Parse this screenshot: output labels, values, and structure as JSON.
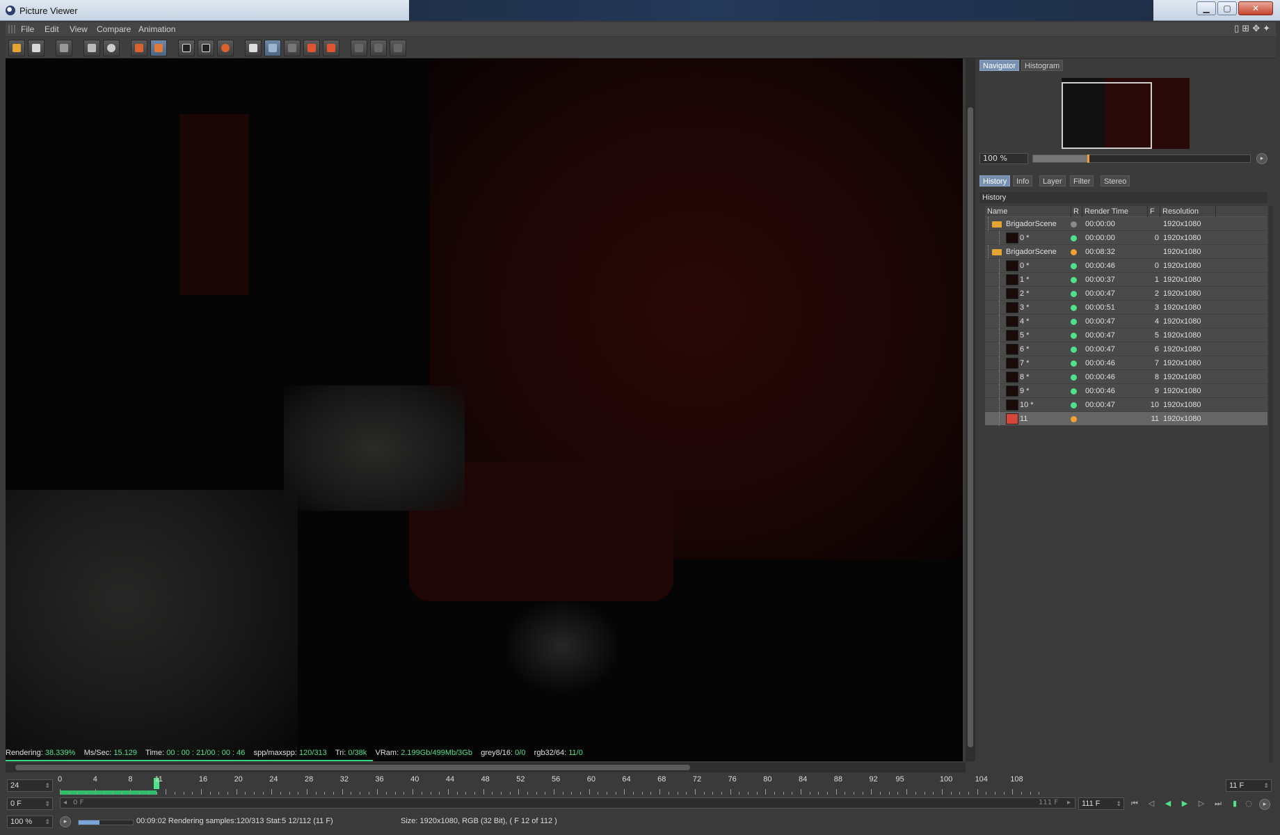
{
  "window": {
    "title": "Picture Viewer"
  },
  "menu": [
    "File",
    "Edit",
    "View",
    "Compare",
    "Animation"
  ],
  "status": {
    "rendering_label": "Rendering:",
    "rendering": "38.339%",
    "ms_label": "Ms/Sec:",
    "ms": "15.129",
    "time_label": "Time:",
    "time": "00 : 00 : 21/00 : 00 : 46",
    "spp_label": "spp/maxspp:",
    "spp": "120/313",
    "tri_label": "Tri:",
    "tri": "0/38k",
    "vram_label": "VRam:",
    "vram": "2.199Gb/499Mb/3Gb",
    "grey_label": "grey8/16:",
    "grey": "0/0",
    "rgb_label": "rgb32/64:",
    "rgb": "11/0",
    "progress": 0.38339
  },
  "panel": {
    "top_tabs": [
      "Navigator",
      "Histogram"
    ],
    "zoom": "100 %",
    "tabs": [
      "History",
      "Info",
      "Layer",
      "Filter",
      "Stereo"
    ],
    "history_title": "History",
    "columns": [
      "Name",
      "R",
      "Render Time",
      "F",
      "Resolution"
    ],
    "rows": [
      {
        "name": "BrigadorScene",
        "kind": "folder",
        "level": 0,
        "status": "grey",
        "time": "00:00:00",
        "frame": "",
        "res": "1920x1080"
      },
      {
        "name": "0 *",
        "kind": "frame",
        "level": 1,
        "status": "green",
        "time": "00:00:00",
        "frame": "0",
        "res": "1920x1080"
      },
      {
        "name": "BrigadorScene",
        "kind": "folder",
        "level": 0,
        "status": "orange",
        "time": "00:08:32",
        "frame": "",
        "res": "1920x1080"
      },
      {
        "name": "0 *",
        "kind": "frame",
        "level": 1,
        "status": "green",
        "time": "00:00:46",
        "frame": "0",
        "res": "1920x1080"
      },
      {
        "name": "1 *",
        "kind": "frame",
        "level": 1,
        "status": "green",
        "time": "00:00:37",
        "frame": "1",
        "res": "1920x1080"
      },
      {
        "name": "2 *",
        "kind": "frame",
        "level": 1,
        "status": "green",
        "time": "00:00:47",
        "frame": "2",
        "res": "1920x1080"
      },
      {
        "name": "3 *",
        "kind": "frame",
        "level": 1,
        "status": "green",
        "time": "00:00:51",
        "frame": "3",
        "res": "1920x1080"
      },
      {
        "name": "4 *",
        "kind": "frame",
        "level": 1,
        "status": "green",
        "time": "00:00:47",
        "frame": "4",
        "res": "1920x1080"
      },
      {
        "name": "5 *",
        "kind": "frame",
        "level": 1,
        "status": "green",
        "time": "00:00:47",
        "frame": "5",
        "res": "1920x1080"
      },
      {
        "name": "6 *",
        "kind": "frame",
        "level": 1,
        "status": "green",
        "time": "00:00:47",
        "frame": "6",
        "res": "1920x1080"
      },
      {
        "name": "7 *",
        "kind": "frame",
        "level": 1,
        "status": "green",
        "time": "00:00:46",
        "frame": "7",
        "res": "1920x1080"
      },
      {
        "name": "8 *",
        "kind": "frame",
        "level": 1,
        "status": "green",
        "time": "00:00:46",
        "frame": "8",
        "res": "1920x1080"
      },
      {
        "name": "9 *",
        "kind": "frame",
        "level": 1,
        "status": "green",
        "time": "00:00:46",
        "frame": "9",
        "res": "1920x1080"
      },
      {
        "name": "10 *",
        "kind": "frame",
        "level": 1,
        "status": "green",
        "time": "00:00:47",
        "frame": "10",
        "res": "1920x1080"
      },
      {
        "name": "11",
        "kind": "current",
        "level": 1,
        "status": "orange",
        "time": "",
        "frame": "11",
        "res": "1920x1080",
        "selected": true
      }
    ]
  },
  "timeline": {
    "fps": "24",
    "frame_field": "0 F",
    "current_field": "11 F",
    "ruler_labels": [
      "0",
      "4",
      "8",
      "11",
      "16",
      "20",
      "24",
      "28",
      "32",
      "36",
      "40",
      "44",
      "48",
      "52",
      "56",
      "60",
      "64",
      "68",
      "72",
      "76",
      "80",
      "84",
      "88",
      "92",
      "95",
      "100",
      "104",
      "108"
    ],
    "current_frame": 11,
    "max_frame": 111,
    "range_start": "0 F",
    "range_end": "111 F",
    "end_field": "111 F"
  },
  "statusbar": {
    "zoom": "100 %",
    "render_info": "00:09:02 Rendering samples:120/313 Stat:5 12/112 (11 F)",
    "size_info": "Size: 1920x1080, RGB (32 Bit),  ( F 12 of 112 )"
  },
  "colors": {
    "green": "#4fe08a",
    "orange": "#f0a030",
    "grey": "#8a8a8a",
    "accent": "#7891b3"
  }
}
